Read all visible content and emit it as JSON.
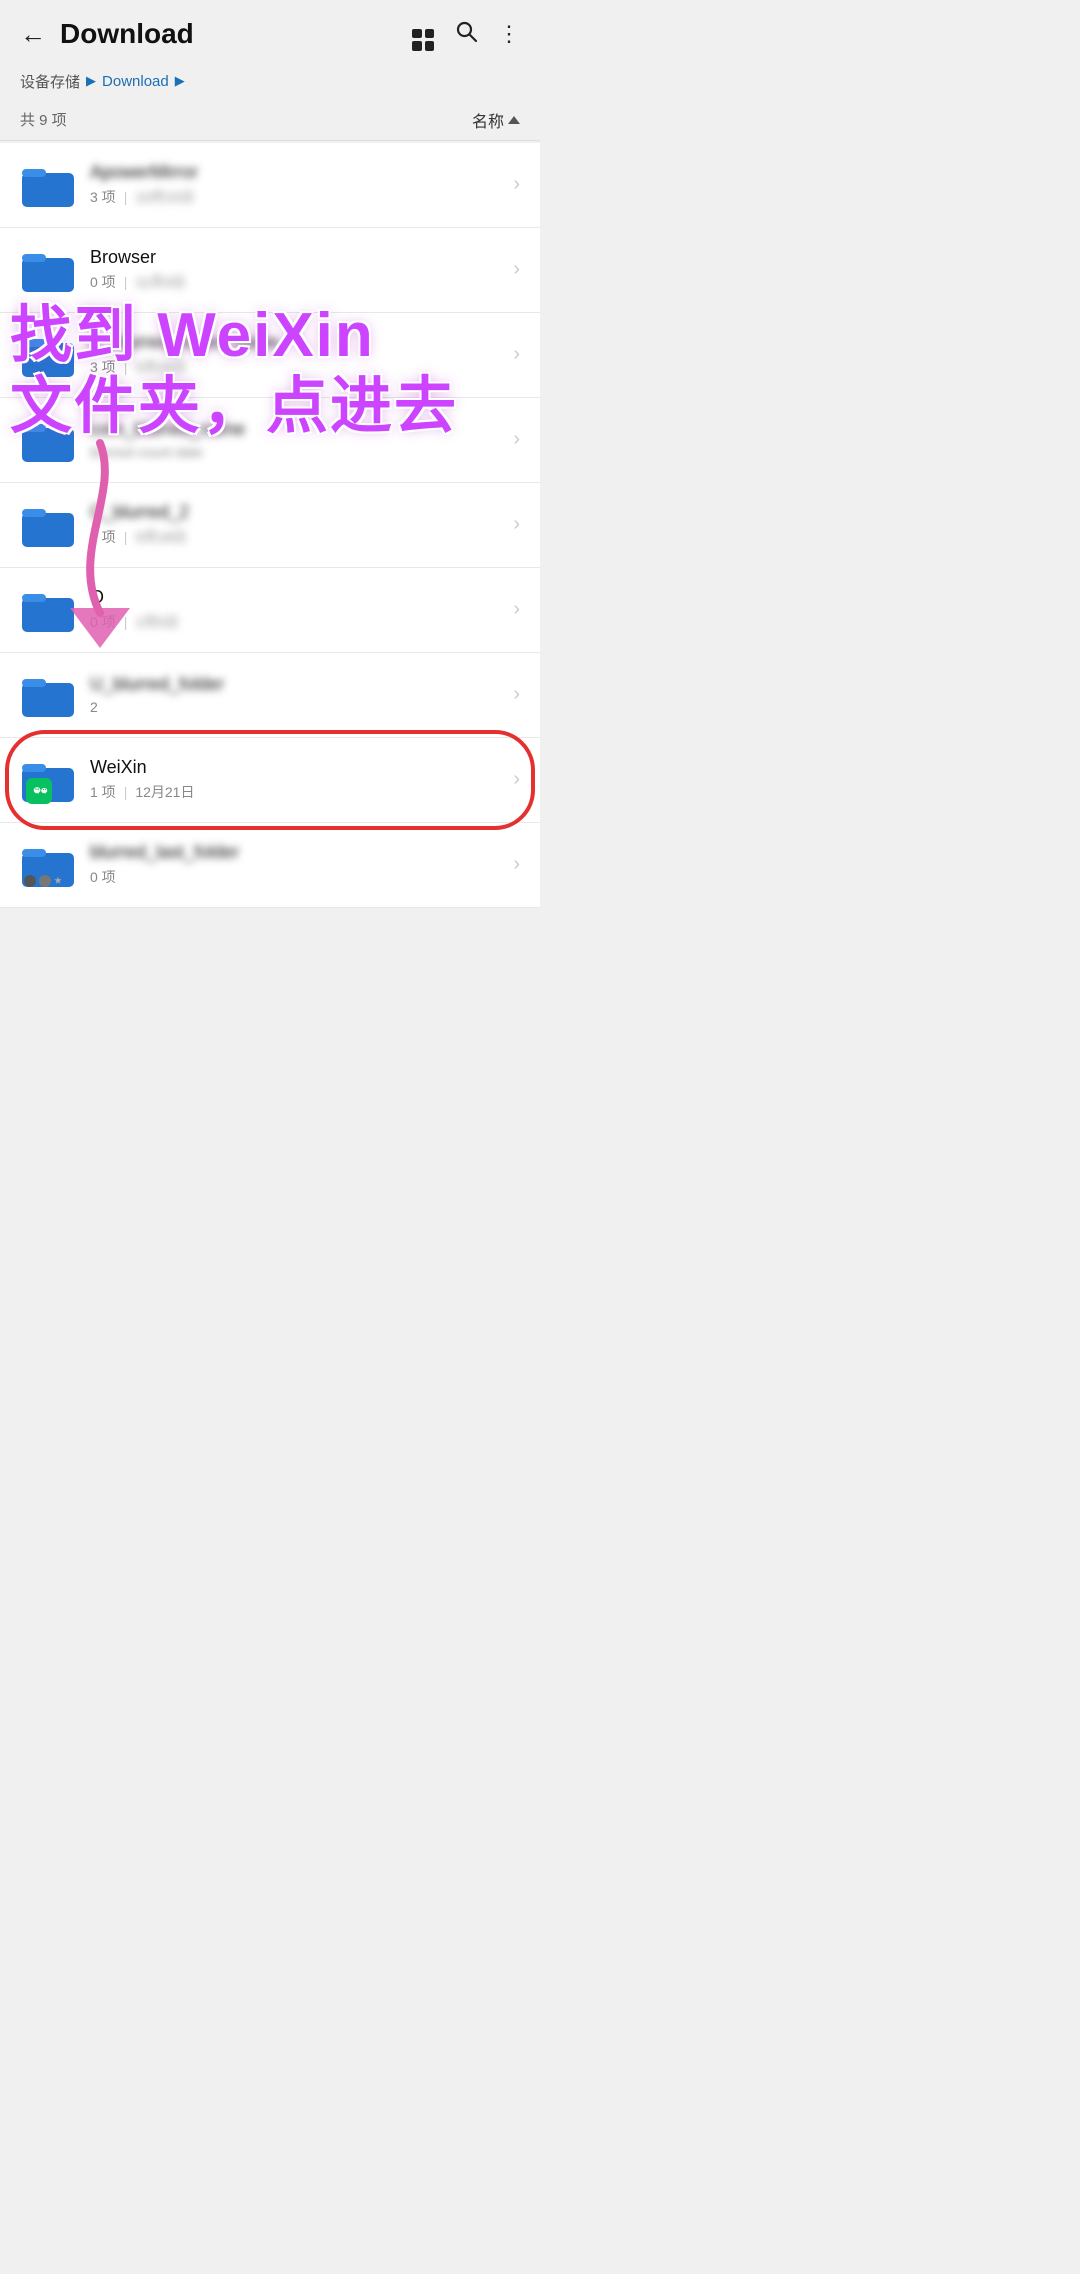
{
  "header": {
    "title": "Download",
    "back_label": "←",
    "grid_icon": "grid",
    "search_icon": "search",
    "more_icon": "more"
  },
  "breadcrumb": {
    "root": "设备存储",
    "current": "Download"
  },
  "count": {
    "text": "共 9 项",
    "sort_label": "名称"
  },
  "annotation": {
    "line1": "找到 WeiXin",
    "line2": "文件夹，点进去"
  },
  "files": [
    {
      "id": "folder1",
      "name": "blurred_name_1",
      "blurred_name": true,
      "count": "3 项",
      "date": "blurred_date",
      "date_blurred": true,
      "special": "none"
    },
    {
      "id": "folder-browser",
      "name": "Browser",
      "blurred_name": false,
      "count": "0 项",
      "date": "blurred_date",
      "date_blurred": true,
      "special": "none"
    },
    {
      "id": "folder3",
      "name": "blurred_name_3",
      "blurred_name": true,
      "count": "3 项",
      "date": "blurred_date",
      "date_blurred": true,
      "special": "none"
    },
    {
      "id": "folder4",
      "name": "blurred_name_4",
      "blurred_name": true,
      "count": "blurred_count",
      "date": "blurred_date",
      "date_blurred": true,
      "special": "none"
    },
    {
      "id": "folder5",
      "name": "blurred_name_5",
      "blurred_name": true,
      "count": "0 项",
      "date": "blurred_date",
      "date_blurred": true,
      "special": "none"
    },
    {
      "id": "folder6",
      "name": "O",
      "blurred_name": false,
      "count": "0 项",
      "date": "blurred_date",
      "date_blurred": true,
      "special": "none"
    },
    {
      "id": "folder7",
      "name": "blurred_name_7",
      "blurred_name": true,
      "count": "2",
      "date": "",
      "date_blurred": false,
      "special": "none"
    },
    {
      "id": "folder-weixin",
      "name": "WeiXin",
      "blurred_name": false,
      "count": "1 项",
      "date": "12月21日",
      "date_blurred": false,
      "special": "weixin"
    },
    {
      "id": "folder9",
      "name": "blurred_name_9",
      "blurred_name": true,
      "count": "0 项",
      "date": "",
      "date_blurred": false,
      "special": "dots"
    }
  ]
}
